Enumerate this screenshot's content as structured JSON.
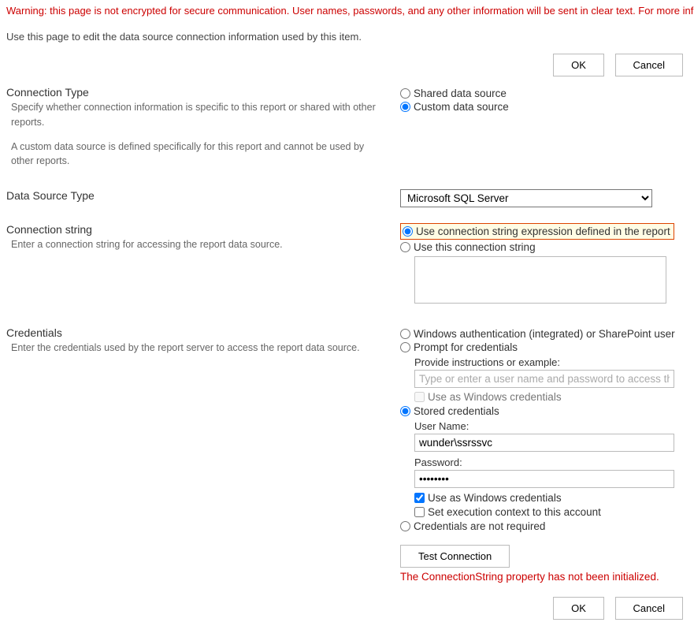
{
  "warning_text": "Warning: this page is not encrypted for secure communication. User names, passwords, and any other information will be sent in clear text. For more infor",
  "intro_text": "Use this page to edit the data source connection information used by this item.",
  "buttons": {
    "ok": "OK",
    "cancel": "Cancel",
    "test": "Test Connection"
  },
  "conn_type": {
    "title": "Connection Type",
    "desc": "Specify whether connection information is specific to this report or shared with other reports.",
    "note": "A custom data source is defined specifically for this report and cannot be used by other reports.",
    "shared": "Shared data source",
    "custom": "Custom data source"
  },
  "ds_type": {
    "title": "Data Source Type",
    "value": "Microsoft SQL Server"
  },
  "conn_string": {
    "title": "Connection string",
    "desc": "Enter a connection string for accessing the report data source.",
    "opt_expr": "Use connection string expression defined in the report",
    "opt_this": "Use this connection string"
  },
  "creds": {
    "title": "Credentials",
    "desc": "Enter the credentials used by the report server to access the report data source.",
    "winauth": "Windows authentication (integrated) or SharePoint user",
    "prompt": "Prompt for credentials",
    "prompt_hint": "Provide instructions or example:",
    "prompt_placeholder": "Type or enter a user name and password to access the d",
    "use_win1": "Use as Windows credentials",
    "stored": "Stored credentials",
    "user_label": "User Name:",
    "user_value": "wunder\\ssrssvc",
    "pass_label": "Password:",
    "pass_value": "••••••••",
    "use_win2": "Use as Windows credentials",
    "set_exec": "Set execution context to this account",
    "not_required": "Credentials are not required"
  },
  "error_text": "The ConnectionString property has not been initialized."
}
